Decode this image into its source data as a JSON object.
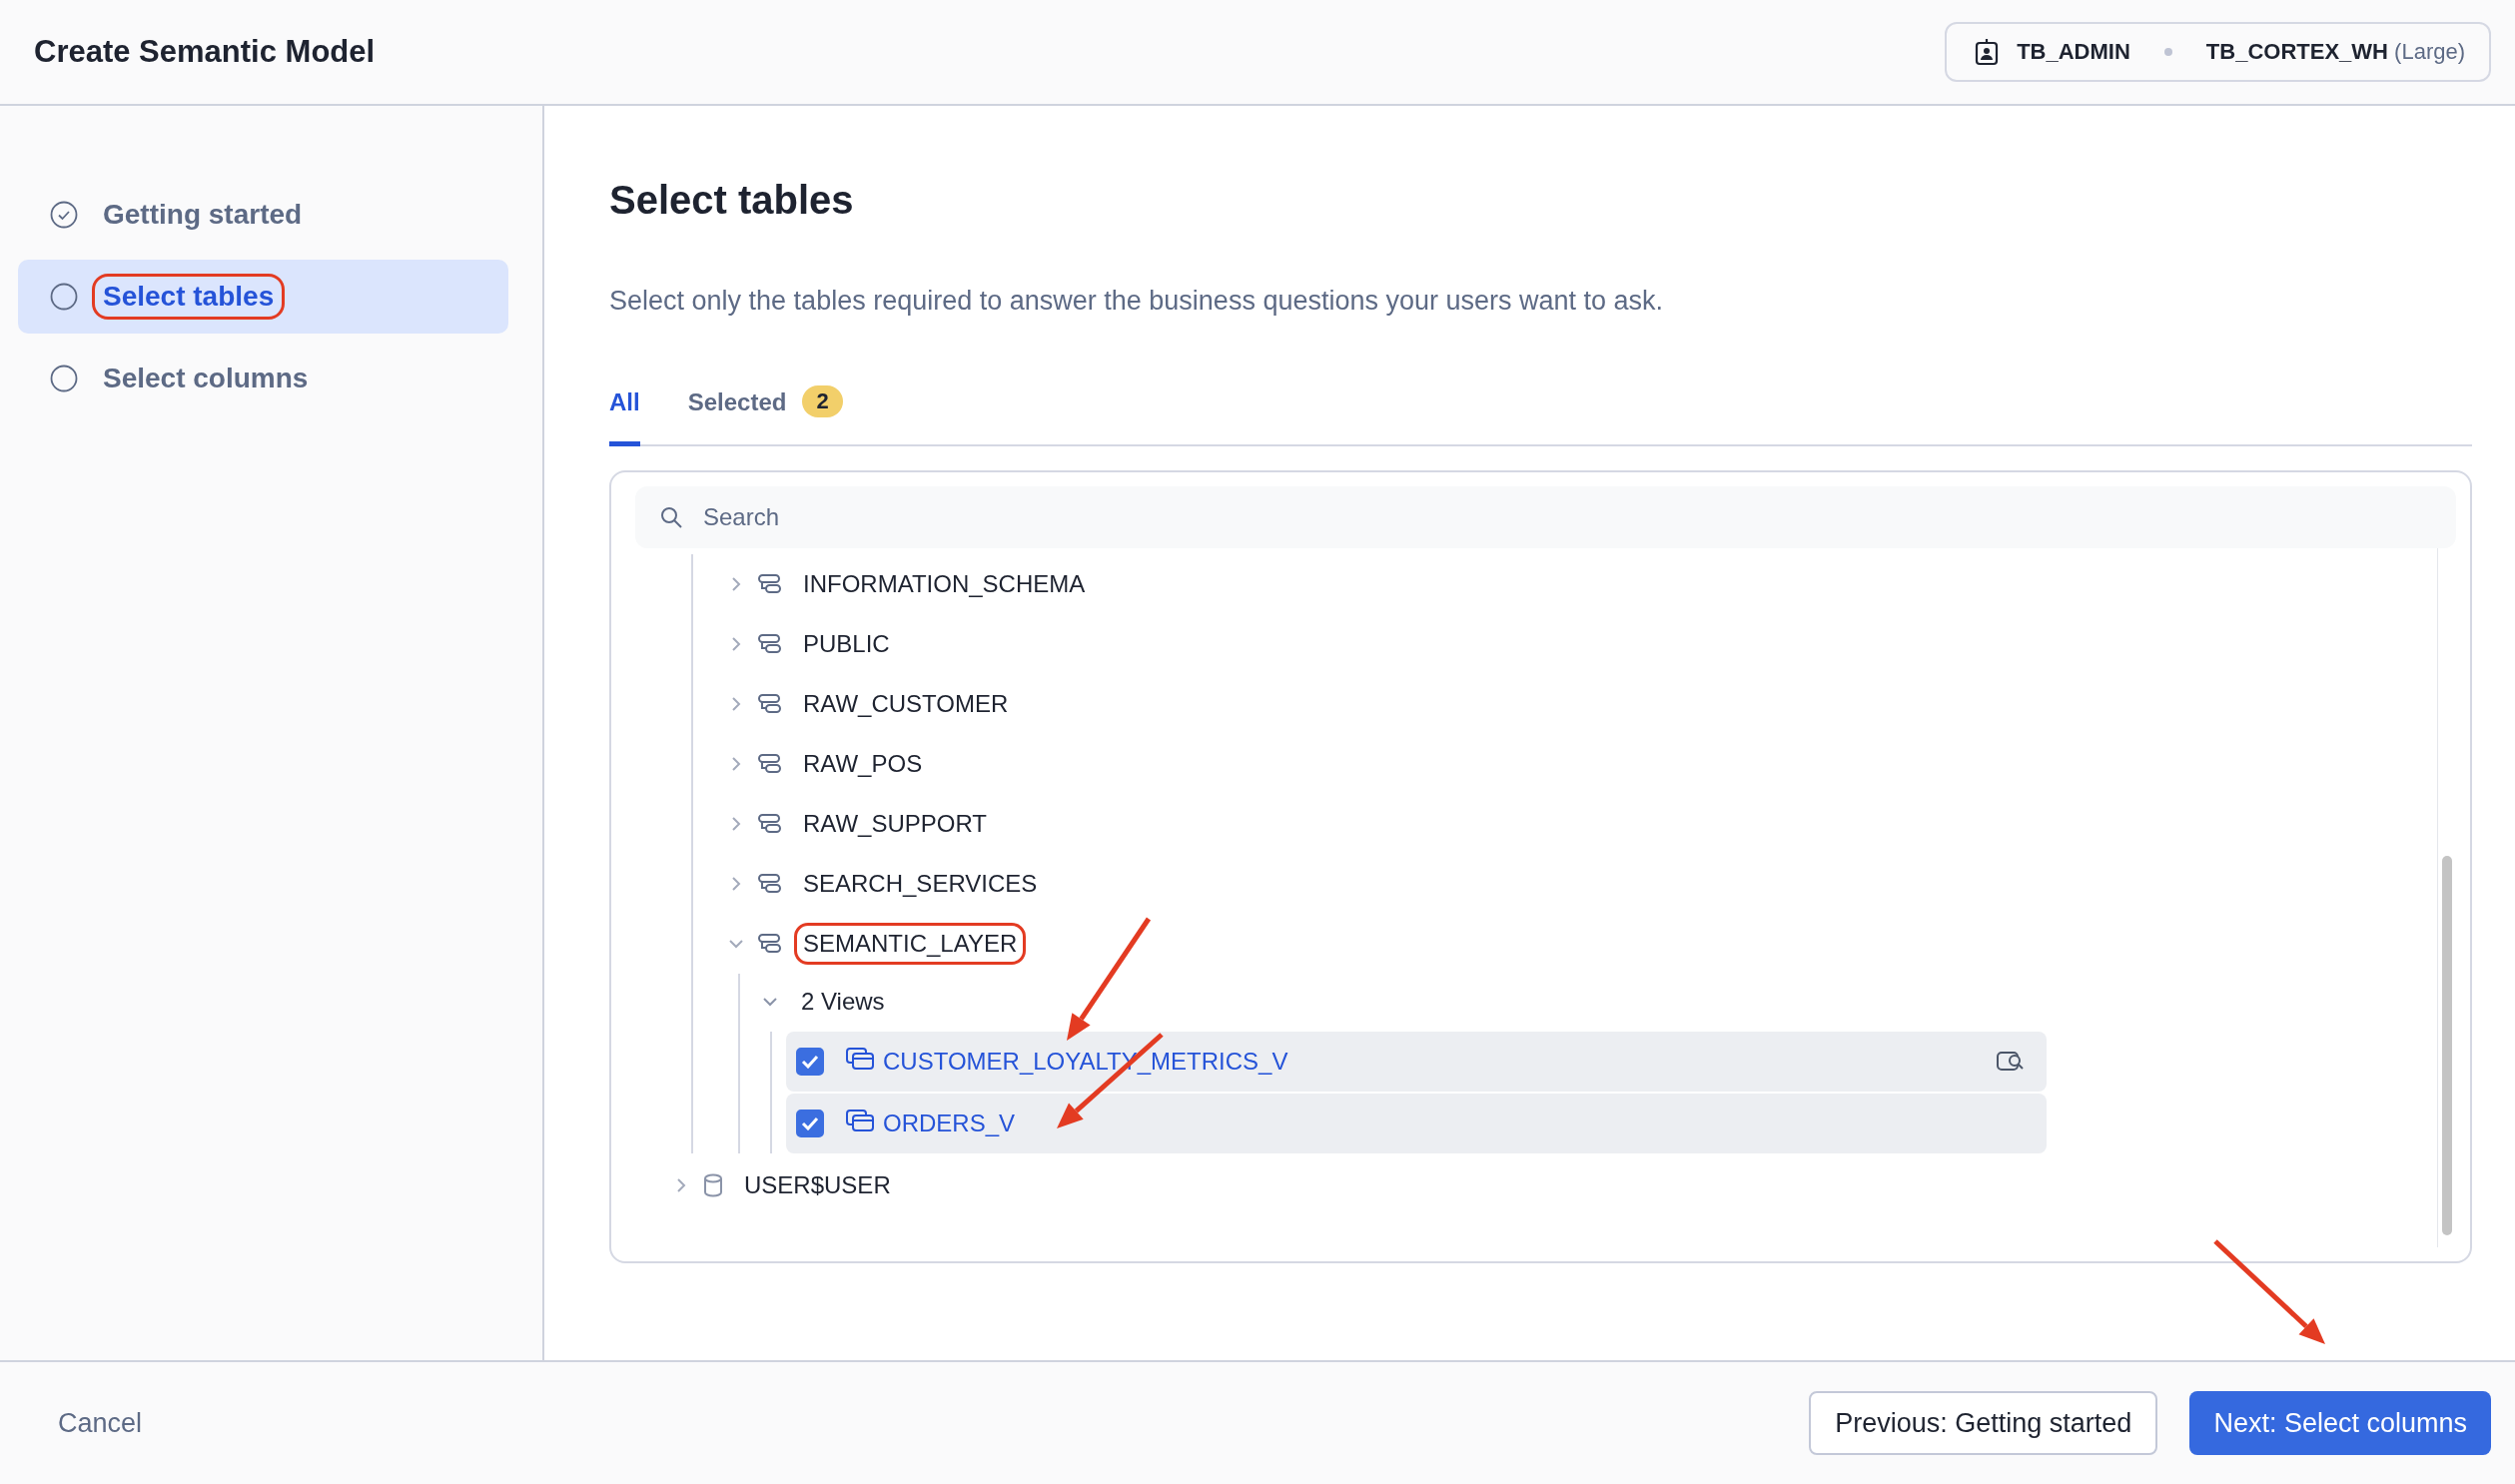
{
  "window": {
    "title": "Create Semantic Model"
  },
  "account": {
    "user": "TB_ADMIN",
    "warehouse": "TB_CORTEX_WH",
    "size": "(Large)"
  },
  "steps": [
    {
      "label": "Getting started",
      "completed": true,
      "selected": false,
      "annotated": false
    },
    {
      "label": "Select tables",
      "completed": false,
      "selected": true,
      "annotated": true
    },
    {
      "label": "Select columns",
      "completed": false,
      "selected": false,
      "annotated": false
    }
  ],
  "heading": "Select tables",
  "description": "Select only the tables required to answer the business questions your users want to ask.",
  "tabs": [
    {
      "label": "All",
      "selected": true
    },
    {
      "label": "Selected",
      "selected": false,
      "count": "2"
    }
  ],
  "search": {
    "placeholder": "Search"
  },
  "tree": [
    {
      "kind": "continued",
      "children": [
        {
          "kind": "schema",
          "label": "INFORMATION_SCHEMA",
          "expanded": false,
          "annotated": false
        },
        {
          "kind": "schema",
          "label": "PUBLIC",
          "expanded": false,
          "annotated": false
        },
        {
          "kind": "schema",
          "label": "RAW_CUSTOMER",
          "expanded": false,
          "annotated": false
        },
        {
          "kind": "schema",
          "label": "RAW_POS",
          "expanded": false,
          "annotated": false
        },
        {
          "kind": "schema",
          "label": "RAW_SUPPORT",
          "expanded": false,
          "annotated": false
        },
        {
          "kind": "schema",
          "label": "SEARCH_SERVICES",
          "expanded": false,
          "annotated": false
        },
        {
          "kind": "schema",
          "label": "SEMANTIC_LAYER",
          "expanded": true,
          "annotated": true,
          "children": [
            {
              "kind": "group",
              "label": "2 Views",
              "expanded": true,
              "children": [
                {
                  "kind": "view",
                  "label": "CUSTOMER_LOYALTY_METRICS_V",
                  "checked": true,
                  "hovered": true
                },
                {
                  "kind": "view",
                  "label": "ORDERS_V",
                  "checked": true,
                  "hovered": false
                }
              ]
            }
          ]
        }
      ]
    },
    {
      "kind": "database",
      "label": "USER$USER",
      "expanded": false,
      "annotated": false
    }
  ],
  "footer": {
    "cancel": "Cancel",
    "previous": "Previous: Getting started",
    "next": "Next: Select columns"
  }
}
